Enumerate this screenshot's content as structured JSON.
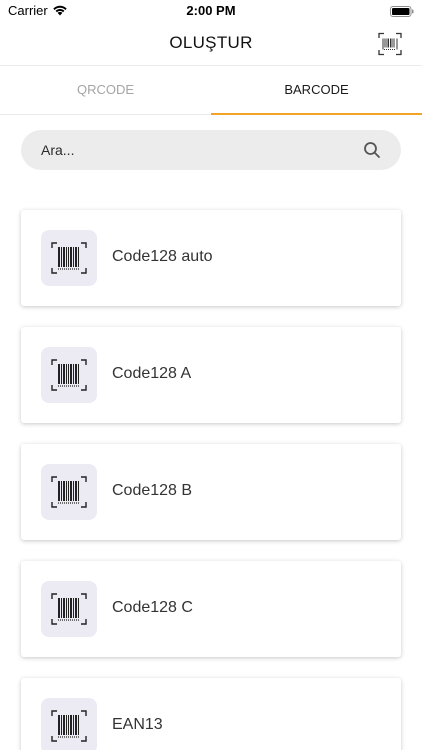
{
  "status_bar": {
    "carrier": "Carrier",
    "time": "2:00 PM"
  },
  "nav": {
    "title": "OLUŞTUR",
    "scan_icon": "barcode-scan-icon"
  },
  "tabs": [
    {
      "label": "QRCODE",
      "active": false
    },
    {
      "label": "BARCODE",
      "active": true
    }
  ],
  "accent_color": "#f3a326",
  "search": {
    "placeholder": "Ara...",
    "value": "",
    "icon": "search-icon"
  },
  "barcodes": [
    {
      "label": "Code128 auto",
      "icon": "barcode-icon"
    },
    {
      "label": "Code128 A",
      "icon": "barcode-icon"
    },
    {
      "label": "Code128 B",
      "icon": "barcode-icon"
    },
    {
      "label": "Code128 C",
      "icon": "barcode-icon"
    },
    {
      "label": "EAN13",
      "icon": "barcode-icon"
    }
  ]
}
